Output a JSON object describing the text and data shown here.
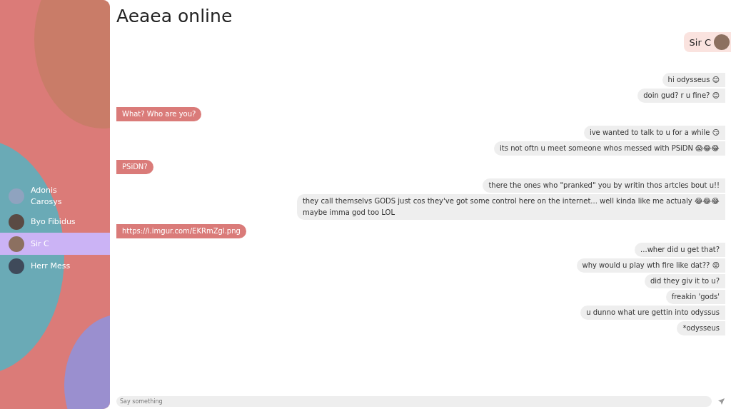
{
  "sidebar": {
    "contacts": [
      {
        "name": "Adonis Carosys",
        "selected": false
      },
      {
        "name": "Byo Fibidus",
        "selected": false
      },
      {
        "name": "Sir C",
        "selected": true
      },
      {
        "name": "Herr Mess",
        "selected": false
      }
    ]
  },
  "chat": {
    "title": "Aeaea online",
    "contact": {
      "name": "Sir C"
    },
    "messages": [
      {
        "kind": "received",
        "text": "hi odysseus 😊"
      },
      {
        "kind": "received",
        "text": "doin gud? r u fine? 😊"
      },
      {
        "kind": "sent",
        "text": "What? Who are you?"
      },
      {
        "kind": "received",
        "text": "ive wanted to talk to u for a while 😏"
      },
      {
        "kind": "received",
        "text": "its not oftn u meet someone whos messed with PSiDN 😱😂😂"
      },
      {
        "kind": "sent",
        "text": "PSiDN?"
      },
      {
        "kind": "received",
        "text": "there the ones who \"pranked\" you by writin thos artcles bout u!!"
      },
      {
        "kind": "received",
        "text": "they call themselvs GODS just cos they've got some control here on the internet... well kinda like me actualy 😂😂😂\nmaybe imma god too LOL"
      },
      {
        "kind": "sent",
        "text": "https://i.imgur.com/EKRmZgl.png"
      },
      {
        "kind": "received",
        "text": "...wher did u get that?"
      },
      {
        "kind": "received",
        "text": "why would u play wth fire like dat?? 😡"
      },
      {
        "kind": "received",
        "text": "did they giv it to u?"
      },
      {
        "kind": "received",
        "text": "freakin 'gods'"
      },
      {
        "kind": "received",
        "text": "u dunno what ure gettin into odyssus"
      },
      {
        "kind": "received",
        "text": "*odysseus"
      }
    ],
    "input": {
      "placeholder": "Say something"
    }
  }
}
